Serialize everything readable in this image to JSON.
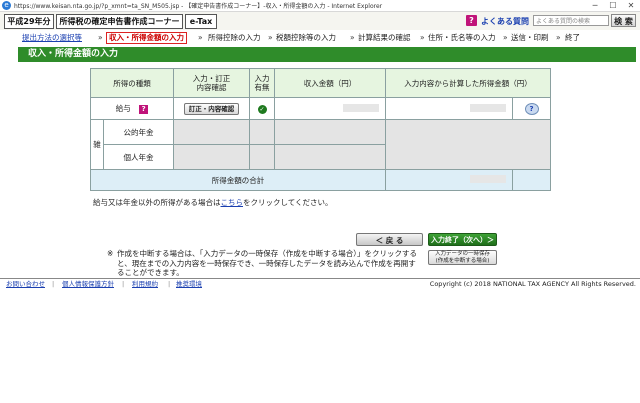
{
  "browser": {
    "title": "https://www.keisan.nta.go.jp/?p_xmnt=ta_SN_M505.jsp - 【確定申告書作成コーナー】-収入・所得金額の入力 - Internet Explorer"
  },
  "header": {
    "year": "平成29年分",
    "corner": "所得税の確定申告書作成コーナー",
    "etax": "e-Tax",
    "faq_icon": "?",
    "faq_link": "よくある質問",
    "search_placeholder": "よくある質問の検索",
    "search_button": "検 索"
  },
  "steps": {
    "items": [
      {
        "label": "提出方法の選択等",
        "state": "link"
      },
      {
        "label": "収入・所得金額の入力",
        "state": "current"
      },
      {
        "label": "所得控除の入力",
        "state": "normal"
      },
      {
        "label": "税額控除等の入力",
        "state": "normal"
      },
      {
        "label": "計算結果の確認",
        "state": "normal"
      },
      {
        "label": "住所・氏名等の入力",
        "state": "normal"
      },
      {
        "label": "送信・印刷",
        "state": "normal"
      },
      {
        "label": "終了",
        "state": "normal"
      }
    ],
    "arrow": "»"
  },
  "section_title": "収入・所得金額の入力",
  "table": {
    "headers": {
      "type": "所得の種類",
      "input": "入力・訂正\n内容確認",
      "entered": "入力\n有無",
      "income": "収入金額（円）",
      "calc": "入力内容から計算した所得金額（円）"
    },
    "salary": {
      "label": "給与",
      "help_icon": "?",
      "button": "訂正・内容確認"
    },
    "misc_group": "雑",
    "pension_public": "公的年金",
    "pension_private": "個人年金",
    "total_label": "所得金額の合計"
  },
  "note1": {
    "before": "給与又は年金以外の所得がある場合は",
    "link": "こちら",
    "after": "をクリックしてください。"
  },
  "nav": {
    "back": "＜ 戻 る",
    "next": "入力終了（次へ）＞",
    "save_line1": "入力データの一時保存",
    "save_line2": "(作成を中断する場合)"
  },
  "note2": {
    "mark": "※",
    "text": "作成を中断する場合は、「入力データの一時保存（作成を中断する場合）」をクリックすると、現在までの入力内容を一時保存でき、一時保存したデータを読み込んで作成を再開することができます。"
  },
  "footer": {
    "links": [
      "お問い合わせ",
      "個人情報保護方針",
      "利用規約",
      "推奨環境"
    ],
    "copyright": "Copyright (c) 2018 NATIONAL TAX AGENCY All Rights Reserved."
  }
}
